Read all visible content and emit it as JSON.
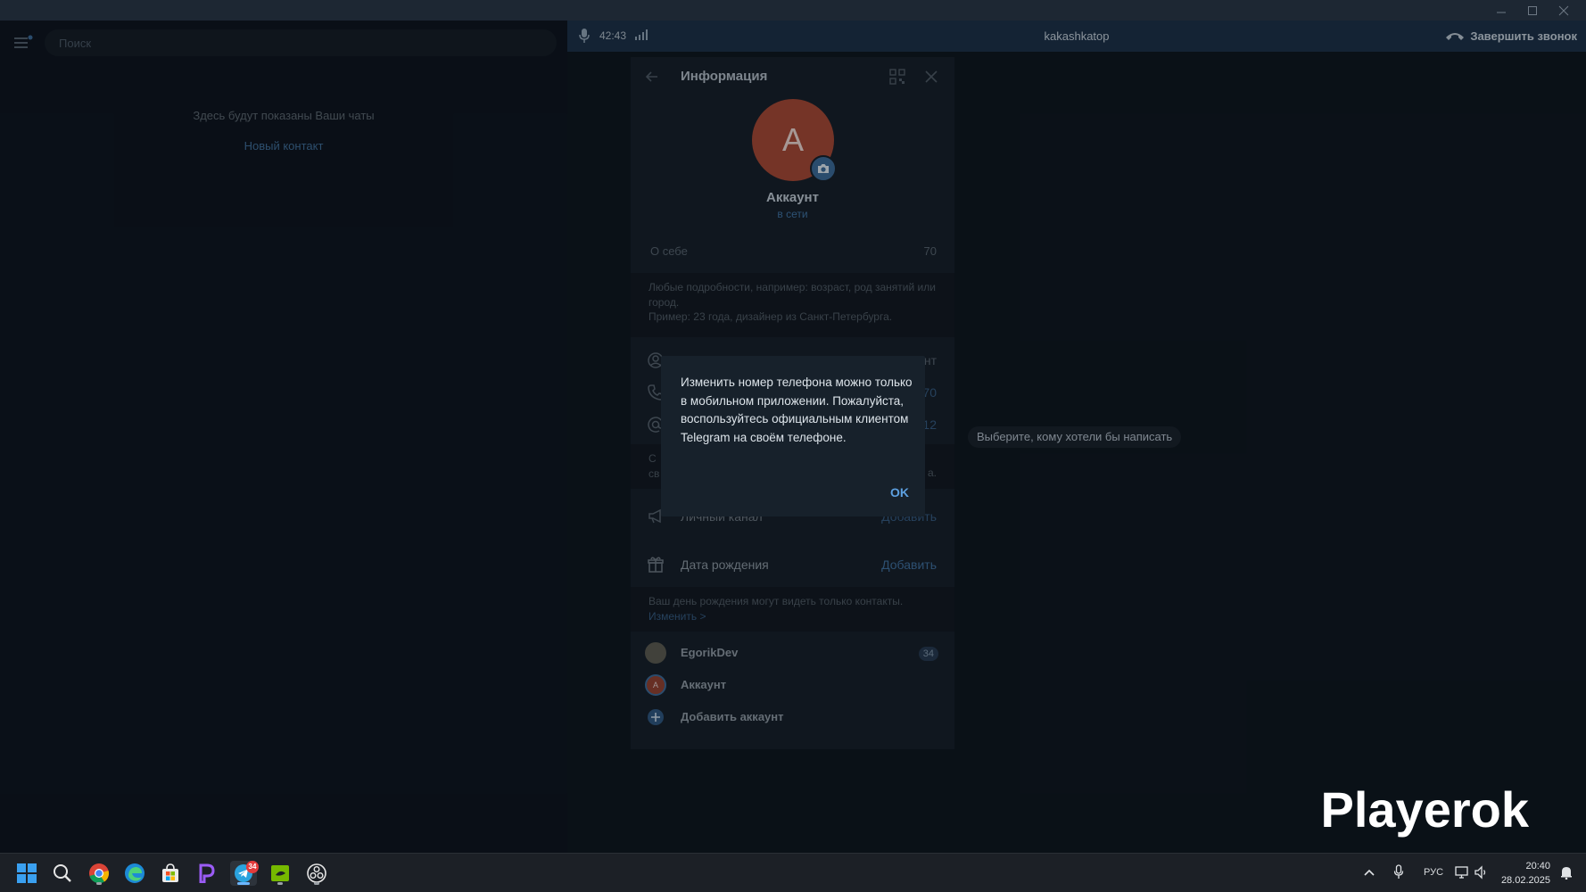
{
  "search": {
    "placeholder": "Поиск"
  },
  "chats": {
    "empty_text": "Здесь будут показаны Ваши чаты",
    "new_contact": "Новый контакт"
  },
  "call": {
    "timer": "42:43",
    "user": "kakashkatop",
    "end_label": "Завершить звонок"
  },
  "chat_area": {
    "hint": "Выберите, кому хотели бы написать"
  },
  "info": {
    "title": "Информация",
    "avatar_letter": "А",
    "name": "Аккаунт",
    "status": "в сети",
    "about_label": "О себе",
    "about_count": "70",
    "about_hint": "Любые подробности, например: возраст, род занятий или город.\nПример: 23 года, дизайнер из Санкт-Петербурга.",
    "rows": [
      {
        "icon": "user-circle-icon",
        "value_partial": "нт"
      },
      {
        "icon": "phone-icon",
        "value_partial": "70"
      },
      {
        "icon": "at-icon",
        "value_partial": "12"
      }
    ],
    "username_hint_left1": "С",
    "username_hint_left2": "св",
    "username_hint_right": "а.",
    "channel_label": "Личный канал",
    "channel_action": "Добавить",
    "birthday_label": "Дата рождения",
    "birthday_action": "Добавить",
    "birthday_hint": "Ваш день рождения могут видеть только контакты.",
    "birthday_edit": "Изменить >",
    "accounts": [
      {
        "name": "EgorikDev",
        "badge": "34"
      },
      {
        "name": "Аккаунт",
        "avatar_letter": "А"
      }
    ],
    "add_account": "Добавить аккаунт"
  },
  "modal": {
    "text": "Изменить номер телефона можно только в мобильном приложении. Пожалуйста, воспользуйтесь официальным клиентом Telegram на своём телефоне.",
    "ok": "OK"
  },
  "watermark": "Playerok",
  "taskbar": {
    "telegram_badge": "34",
    "lang": "РУС",
    "time": "20:40",
    "date": "28.02.2025"
  },
  "colors": {
    "accent": "#5da0e0",
    "avatar": "#a24836",
    "callbar": "#1c3149"
  }
}
